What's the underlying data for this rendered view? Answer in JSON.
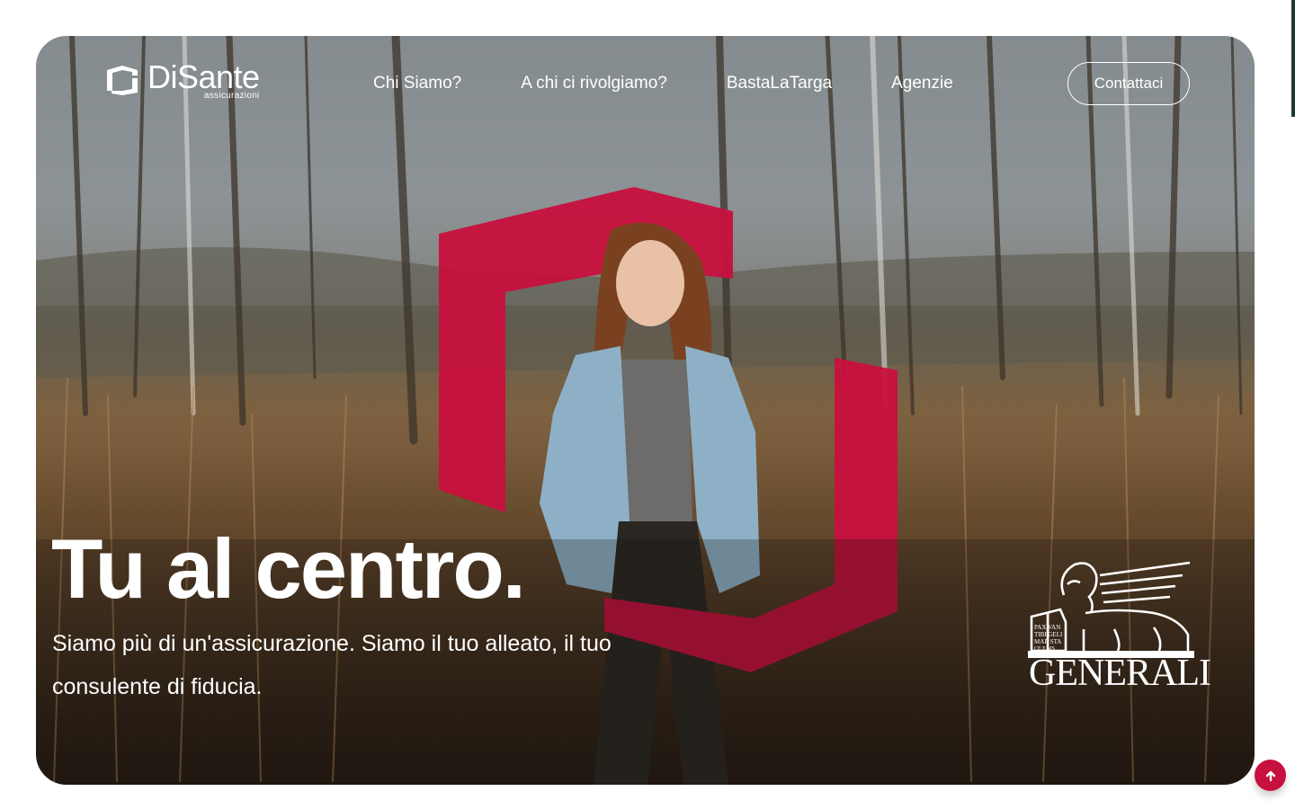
{
  "brand": {
    "name": "DiSante",
    "tagline": "assicurazioni",
    "logo_icon": "disante-logo-icon"
  },
  "nav": {
    "items": [
      {
        "label": "Chi Siamo?"
      },
      {
        "label": "A chi ci rivolgiamo?"
      },
      {
        "label": "BastaLaTarga"
      },
      {
        "label": "Agenzie"
      }
    ],
    "cta_label": "Contattaci"
  },
  "hero": {
    "headline": "Tu al centro.",
    "subtitle": "Siamo più di un'assicurazione. Siamo il tuo alleato, il tuo consulente di fiducia.",
    "partner_logo": {
      "name": "GENERALI",
      "book_inscription": "PAX TIBI MAR CE VAN GELI STA E MS"
    },
    "image": "woman-in-denim-jacket-in-field-photo"
  },
  "scroll_top": {
    "icon": "arrow-up-icon"
  },
  "colors": {
    "accent": "#c8103e",
    "text_on_image": "#ffffff",
    "page_bg": "#ffffff",
    "edge_strip": "#1f3b2d"
  }
}
